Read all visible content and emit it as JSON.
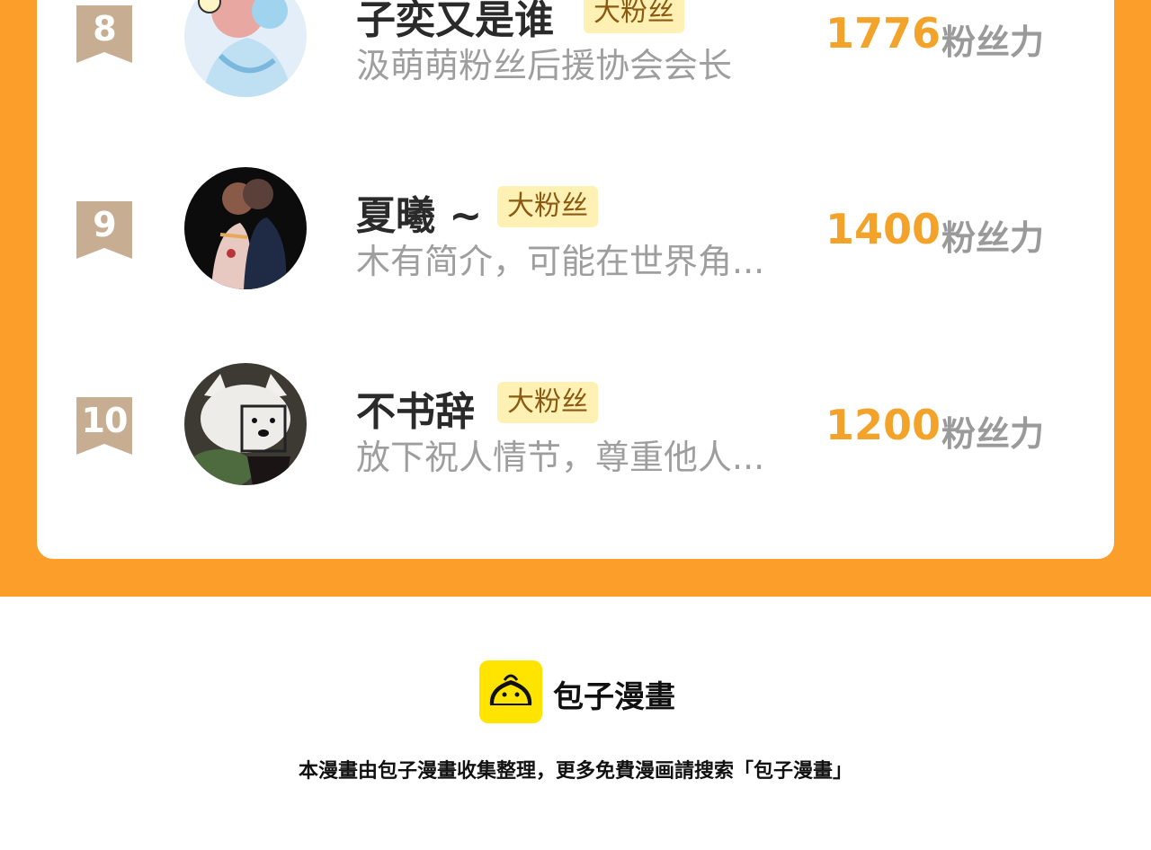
{
  "ranking": [
    {
      "rank": "8",
      "name": "子奕又是谁",
      "tag": "大粉丝",
      "desc": "汲萌萌粉丝后援协会会长",
      "score": "1776",
      "unit": "粉丝力",
      "avatar_icon": "anime-avatar-icon"
    },
    {
      "rank": "9",
      "name": "夏曦 ~",
      "tag": "大粉丝",
      "desc": "木有简介，可能在世界角...",
      "score": "1400",
      "unit": "粉丝力",
      "avatar_icon": "couple-avatar-icon"
    },
    {
      "rank": "10",
      "name": "不书辞",
      "tag": "大粉丝",
      "desc": "放下祝人情节，尊重他人...",
      "score": "1200",
      "unit": "粉丝力",
      "avatar_icon": "dog-avatar-icon"
    }
  ],
  "brand": {
    "name": "包子漫畫",
    "logo_icon": "bun-logo-icon"
  },
  "footer_text": "本漫畫由包子漫畫收集整理，更多免費漫画請搜索「包子漫畫」",
  "colors": {
    "accent": "#FC9F2A",
    "score": "#F3A32A",
    "tag_bg": "#FFF0B3",
    "logo": "#FFE400"
  }
}
